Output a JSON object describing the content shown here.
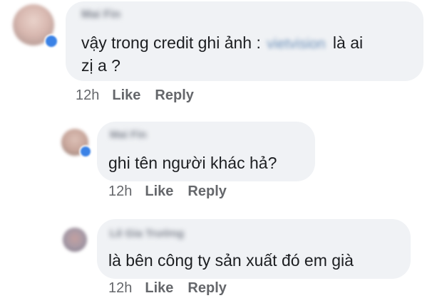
{
  "comments": [
    {
      "author": "Mai Fin",
      "text_before": "vậy trong credit ghi ảnh :",
      "text_hidden": "vietvision",
      "text_after": "là ai",
      "text_line2": "zị a ?",
      "time": "12h",
      "like": "Like",
      "reply": "Reply",
      "avatar_color": "#d8b8b0"
    },
    {
      "author": "Mai Fin",
      "text": "ghi tên người khác hả?",
      "time": "12h",
      "like": "Like",
      "reply": "Reply",
      "avatar_color": "#c9a79c"
    },
    {
      "author": "Lê Gia Trường",
      "text": "là bên công ty sản xuất đó em già",
      "time": "12h",
      "like": "Like",
      "reply": "Reply",
      "avatar_color": "#a89aa6"
    }
  ],
  "colors": {
    "bubble": "#f0f2f5",
    "text": "#1c1e21",
    "meta": "#65676b",
    "badge": "#3b82e6"
  }
}
